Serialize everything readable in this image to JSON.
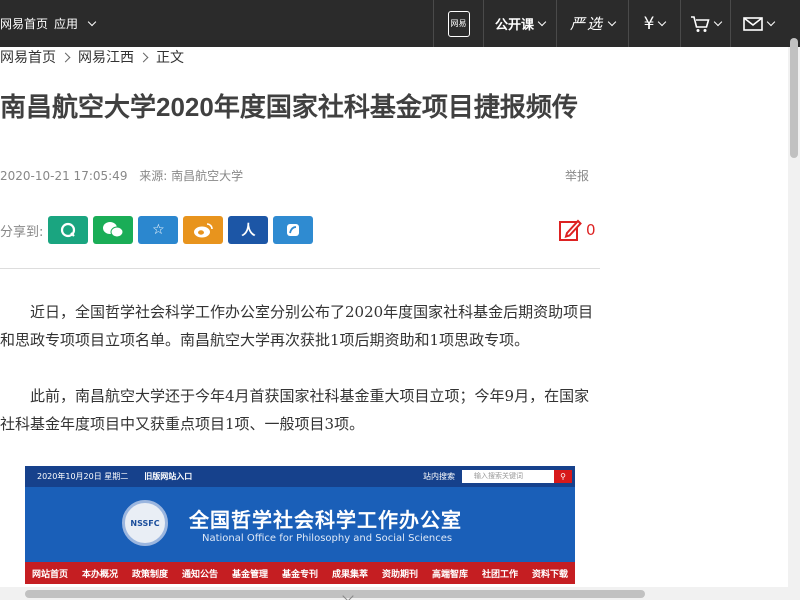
{
  "topbar": {
    "home": "网易首页",
    "apps": "应用",
    "mobile_label": "网易",
    "open_course": "公开课",
    "yanxuan": "严选",
    "yen": "¥"
  },
  "breadcrumb": [
    "网易首页",
    "网易江西",
    "正文"
  ],
  "article": {
    "title": "南昌航空大学2020年度国家社科基金项目捷报频传",
    "datetime": "2020-10-21 17:05:49",
    "source": "来源: 南昌航空大学",
    "report": "举报",
    "share_label": "分享到:",
    "comment_count": "0",
    "paragraphs": [
      "近日，全国哲学社会科学工作办公室分别公布了2020年度国家社科基金后期资助项目和思政专项项目立项名单。南昌航空大学再次获批1项后期资助和1项思政专项。",
      "此前，南昌航空大学还于今年4月首获国家社科基金重大项目立项；今年9月，在国家社科基金年度项目中又获重点项目1项、一般项目3项。"
    ]
  },
  "share_buttons": [
    {
      "name": "qzone",
      "glyph": "Q",
      "color": "#1aa580"
    },
    {
      "name": "wechat",
      "glyph": "●",
      "color": "#1aad57"
    },
    {
      "name": "favorite",
      "glyph": "☆",
      "color": "#2b87cf"
    },
    {
      "name": "weibo",
      "glyph": "◉",
      "color": "#e8941d"
    },
    {
      "name": "renren",
      "glyph": "人",
      "color": "#1c56a6"
    },
    {
      "name": "other",
      "glyph": "◆",
      "color": "#2f8bd1"
    }
  ],
  "embedded_image": {
    "date": "2020年10月20日 星期二",
    "old_site": "旧版网站入口",
    "site_search": "站内搜索",
    "search_placeholder": "输入搜索关键词",
    "logo_text": "NSSFC",
    "title_cn": "全国哲学社会科学工作办公室",
    "title_en": "National Office for Philosophy and Social Sciences",
    "nav": [
      "网站首页",
      "本办概况",
      "政策制度",
      "通知公告",
      "基金管理",
      "基金专刊",
      "成果集萃",
      "资助期刊",
      "高端智库",
      "社团工作",
      "资料下载"
    ]
  },
  "colors": {
    "topbar_bg": "#2b2b2b",
    "comment_red": "#dd2222",
    "image_blue": "#1a5fb8",
    "image_nav_red": "#c51e22"
  }
}
